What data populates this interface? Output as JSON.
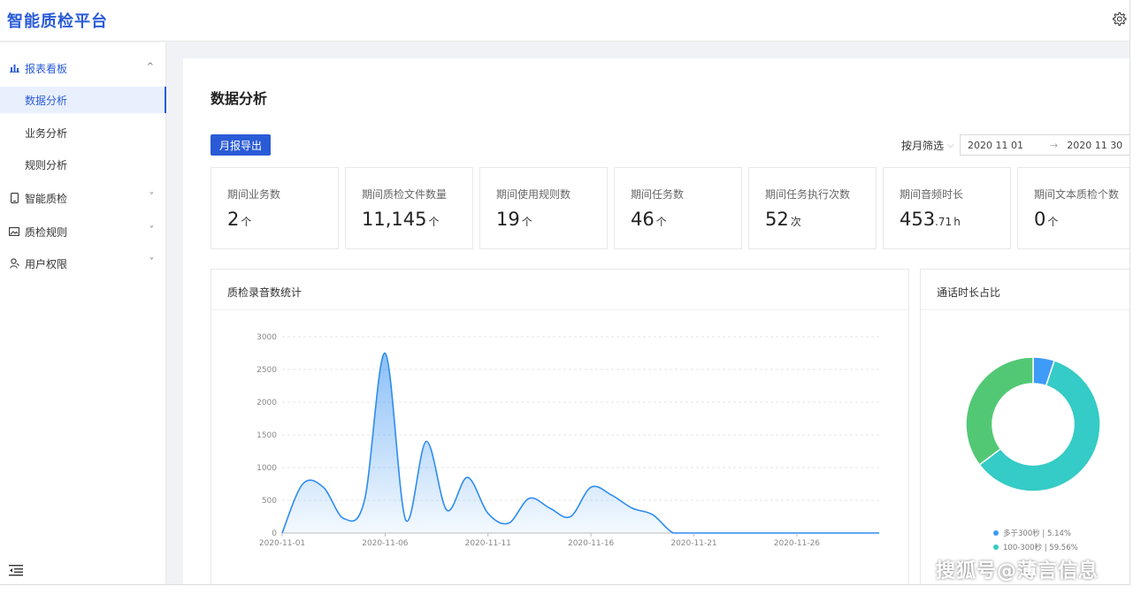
{
  "app": {
    "title": "智能质检平台"
  },
  "sidebar": {
    "groups": [
      {
        "label": "报表看板",
        "icon": "bar-chart-icon",
        "caret": "^"
      },
      {
        "label": "智能质检",
        "icon": "phone-icon",
        "caret": "˅"
      },
      {
        "label": "质检规则",
        "icon": "image-icon",
        "caret": "˅"
      },
      {
        "label": "用户权限",
        "icon": "user-icon",
        "caret": "˅"
      }
    ],
    "subitems": [
      {
        "label": "数据分析"
      },
      {
        "label": "业务分析"
      },
      {
        "label": "规则分析"
      }
    ]
  },
  "main": {
    "title": "数据分析",
    "export_label": "月报导出",
    "filter_label": "按月筛选",
    "date_start": "2020 11 01",
    "date_end": "2020 11 30",
    "range_arrow": "→"
  },
  "stats": [
    {
      "label": "期间业务数",
      "value": "2",
      "unit": "个"
    },
    {
      "label": "期间质检文件数量",
      "value": "11,145",
      "unit": "个"
    },
    {
      "label": "期间使用规则数",
      "value": "19",
      "unit": "个"
    },
    {
      "label": "期间任务数",
      "value": "46",
      "unit": "个"
    },
    {
      "label": "期间任务执行次数",
      "value": "52",
      "unit": "次"
    },
    {
      "label": "期间音频时长",
      "value": "453",
      "sub": ".71",
      "unit": "h"
    },
    {
      "label": "期间文本质检个数",
      "value": "0",
      "unit": "个"
    }
  ],
  "chart_card": {
    "title": "质检录音数统计"
  },
  "pie_card": {
    "title": "通话时长占比"
  },
  "chart_data": [
    {
      "type": "area",
      "title": "质检录音数统计",
      "x": [
        "2020-11-01",
        "2020-11-02",
        "2020-11-03",
        "2020-11-04",
        "2020-11-05",
        "2020-11-06",
        "2020-11-07",
        "2020-11-08",
        "2020-11-09",
        "2020-11-10",
        "2020-11-11",
        "2020-11-12",
        "2020-11-13",
        "2020-11-14",
        "2020-11-15",
        "2020-11-16",
        "2020-11-17",
        "2020-11-18",
        "2020-11-19",
        "2020-11-20",
        "2020-11-21",
        "2020-11-22",
        "2020-11-23",
        "2020-11-24",
        "2020-11-25",
        "2020-11-26",
        "2020-11-27",
        "2020-11-28",
        "2020-11-29",
        "2020-11-30"
      ],
      "values": [
        0,
        750,
        700,
        220,
        500,
        2750,
        200,
        1400,
        350,
        850,
        300,
        150,
        530,
        380,
        250,
        700,
        580,
        380,
        280,
        0,
        0,
        0,
        0,
        0,
        0,
        0,
        0,
        0,
        0,
        0
      ],
      "x_tick_labels": [
        "2020-11-01",
        "2020-11-06",
        "2020-11-11",
        "2020-11-16",
        "2020-11-21",
        "2020-11-26"
      ],
      "y_ticks": [
        0,
        500,
        1000,
        1500,
        2000,
        2500,
        3000
      ],
      "ylim": [
        0,
        3000
      ],
      "grid": true,
      "color": "#2d8cf0"
    },
    {
      "type": "pie",
      "title": "通话时长占比",
      "slices": [
        {
          "name": "多于300秒",
          "percent_label": "5.14%",
          "value": 5.14,
          "color": "#3e9bf7"
        },
        {
          "name": "100-300秒",
          "percent_label": "59.56%",
          "value": 59.56,
          "color": "#35cbc6"
        },
        {
          "name": "",
          "value": 35.3,
          "color": "#52c875"
        }
      ]
    }
  ],
  "watermark": "搜狐号@薄言信息"
}
